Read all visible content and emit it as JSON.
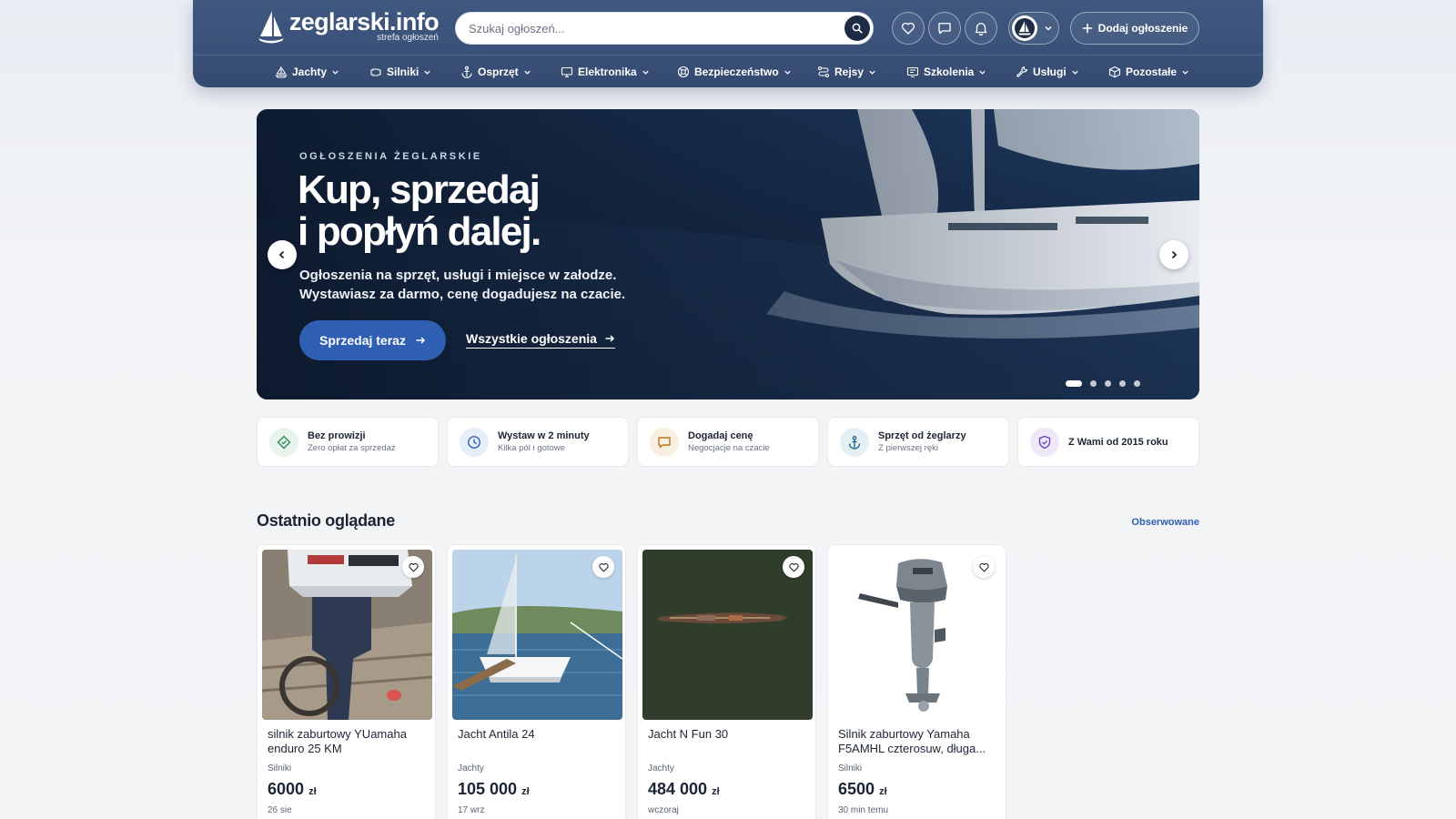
{
  "brand": {
    "name": "zeglarski.info",
    "tagline": "strefa ogłoszeń"
  },
  "search": {
    "placeholder": "Szukaj ogłoszeń..."
  },
  "header": {
    "add_listing_label": "Dodaj ogłoszenie"
  },
  "nav": [
    {
      "label": "Jachty",
      "icon": "sailboat-icon"
    },
    {
      "label": "Silniki",
      "icon": "engine-icon"
    },
    {
      "label": "Osprzęt",
      "icon": "anchor-icon"
    },
    {
      "label": "Elektronika",
      "icon": "monitor-icon"
    },
    {
      "label": "Bezpieczeństwo",
      "icon": "lifebuoy-icon"
    },
    {
      "label": "Rejsy",
      "icon": "route-icon"
    },
    {
      "label": "Szkolenia",
      "icon": "school-icon"
    },
    {
      "label": "Usługi",
      "icon": "wrench-icon"
    },
    {
      "label": "Pozostałe",
      "icon": "box-icon"
    }
  ],
  "hero": {
    "kicker": "OGŁOSZENIA ŻEGLARSKIE",
    "title_line1": "Kup, sprzedaj",
    "title_line2": "i popłyń dalej.",
    "desc_line1": "Ogłoszenia na sprzęt, usługi i miejsce w załodze.",
    "desc_line2": "Wystawiasz za darmo, cenę dogadujesz na czacie.",
    "cta_label": "Sprzedaj teraz",
    "link_label": "Wszystkie ogłoszenia",
    "slides_total": 5,
    "active_slide": 1
  },
  "features": [
    {
      "title": "Bez prowizji",
      "subtitle": "Zero opłat za sprzedaż",
      "icon": "tag-icon",
      "color": "#2e8b57",
      "bg": "#e8f4ec"
    },
    {
      "title": "Wystaw w 2 minuty",
      "subtitle": "Kilka pól i gotowe",
      "icon": "clock-icon",
      "color": "#2f5fb3",
      "bg": "#e6eef9"
    },
    {
      "title": "Dogadaj cenę",
      "subtitle": "Negocjacje na czacie",
      "icon": "chat-icon",
      "color": "#b7791f",
      "bg": "#f8efe1"
    },
    {
      "title": "Sprzęt od żeglarzy",
      "subtitle": "Z pierwszej ręki",
      "icon": "anchor-icon",
      "color": "#2c6e8a",
      "bg": "#e5f0f4"
    },
    {
      "title": "Z Wami od 2015 roku",
      "subtitle": "",
      "icon": "shield-icon",
      "color": "#6b46c1",
      "bg": "#eee8f8"
    }
  ],
  "recent": {
    "title": "Ostatnio oglądane",
    "link_label": "Obserwowane",
    "items": [
      {
        "title": "silnik zaburtowy YUamaha enduro 25 KM",
        "category": "Silniki",
        "price": "6000",
        "currency": "zł",
        "date": "26 sie",
        "image": "outboard-engine-photo"
      },
      {
        "title": "Jacht Antila 24",
        "category": "Jachty",
        "price": "105 000",
        "currency": "zł",
        "date": "17 wrz",
        "image": "yacht-marina-photo"
      },
      {
        "title": "Jacht N Fun 30",
        "category": "Jachty",
        "price": "484 000",
        "currency": "zł",
        "date": "wczoraj",
        "image": "yacht-aerial-photo"
      },
      {
        "title": "Silnik zaburtowy Yamaha F5AMHL czterosuw, długa...",
        "category": "Silniki",
        "price": "6500",
        "currency": "zł",
        "date": "30 min temu",
        "image": "yamaha-outboard-photo"
      }
    ]
  }
}
